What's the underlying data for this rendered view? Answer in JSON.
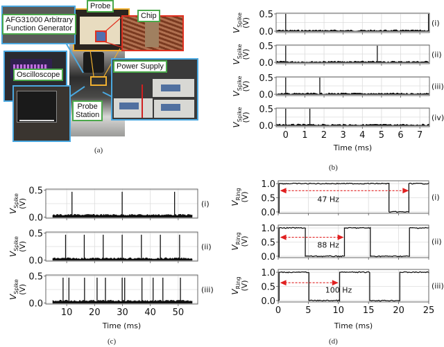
{
  "figure": {
    "panel_a": {
      "caption": "(a)",
      "labels": {
        "afg": "AFG31000 Arbitrary\nFunction Generator",
        "afg_line1": "AFG31000 Arbitrary",
        "afg_line2": "Function Generator",
        "probe": "Probe",
        "chip": "Chip",
        "oscilloscope": "Oscilloscope",
        "power_supply": "Power Supply",
        "probe_station_line1": "Probe",
        "probe_station_line2": "Station"
      },
      "colors": {
        "blue_frame": "#4aa8e0",
        "green_label": "#4aa84a",
        "red_frame": "#e03020",
        "yellow_frame": "#f0b030"
      }
    },
    "panel_b": {
      "caption": "(b)"
    },
    "panel_c": {
      "caption": "(c)"
    },
    "panel_d": {
      "caption": "(d)"
    }
  },
  "chart_data": [
    {
      "id": "b",
      "type": "line",
      "title": "",
      "xlabel": "Time (ms)",
      "ylabel": "V_Spike (V)",
      "xlim": [
        -0.5,
        7.5
      ],
      "ylim": [
        -0.04,
        0.52
      ],
      "xticks": [
        0,
        1,
        2,
        3,
        4,
        5,
        6,
        7
      ],
      "yticks": [
        0.0,
        0.5
      ],
      "ytick_labels": [
        "0.0",
        "0.5"
      ],
      "grid": true,
      "series": [
        {
          "name": "(i)",
          "baseline": 0.02,
          "spikes": [
            0.0,
            7.45
          ],
          "spike_height": 0.5
        },
        {
          "name": "(ii)",
          "baseline": 0.02,
          "spikes": [
            0.0,
            4.78
          ],
          "spike_height": 0.5
        },
        {
          "name": "(iii)",
          "baseline": 0.02,
          "spikes": [
            0.0,
            1.78
          ],
          "spike_height": 0.5
        },
        {
          "name": "(iv)",
          "baseline": 0.02,
          "spikes": [
            0.0,
            1.26
          ],
          "spike_height": 0.5
        }
      ]
    },
    {
      "id": "c",
      "type": "line",
      "title": "",
      "xlabel": "Time (ms)",
      "ylabel": "V_Spike (V)",
      "xlim": [
        2.5,
        57
      ],
      "ylim": [
        -0.02,
        0.52
      ],
      "data_range": [
        5,
        55
      ],
      "xticks": [
        10,
        20,
        30,
        40,
        50
      ],
      "yticks": [
        0.0,
        0.5
      ],
      "ytick_labels": [
        "0.0",
        "0.5"
      ],
      "grid": true,
      "series": [
        {
          "name": "(i)",
          "baseline": 0.04,
          "spikes": [
            11.9,
            29.9,
            48.7
          ],
          "spike_height": 0.47
        },
        {
          "name": "(ii)",
          "baseline": 0.03,
          "spikes": [
            9.6,
            16.3,
            23.1,
            29.9,
            36.8,
            43.6,
            50.5
          ],
          "spike_height": 0.47
        },
        {
          "name": "(iii)",
          "baseline": 0.04,
          "spikes": [
            8.7,
            10.8,
            16.4,
            20.9,
            23.9,
            29.9,
            30.8,
            37.0,
            41.0,
            44.5,
            50.8
          ],
          "spike_height": 0.47
        }
      ]
    },
    {
      "id": "d",
      "type": "line",
      "title": "",
      "xlabel": "Time (ms)",
      "ylabel": "V_Ring (V)",
      "xlim": [
        0,
        25
      ],
      "ylim": [
        -0.05,
        1.1
      ],
      "xticks": [
        0,
        5,
        10,
        15,
        20,
        25
      ],
      "yticks": [
        0.0,
        0.5,
        1.0
      ],
      "ytick_labels": [
        "0.0",
        "0.5",
        "1.0"
      ],
      "grid": true,
      "series": [
        {
          "name": "(i)",
          "frequency_label": "47 Hz",
          "arrow": [
            0.3,
            21.7
          ],
          "arrow_y": 0.75,
          "label_x": 6.5,
          "label_y": 0.45,
          "transitions": [
            [
              0,
              0
            ],
            [
              0.15,
              1
            ],
            [
              18.4,
              0
            ],
            [
              21.7,
              1
            ],
            [
              25,
              1
            ]
          ]
        },
        {
          "name": "(ii)",
          "frequency_label": "88 Hz",
          "arrow": [
            0.3,
            10.9
          ],
          "arrow_y": 0.67,
          "label_x": 6.5,
          "label_y": 0.4,
          "transitions": [
            [
              0,
              0
            ],
            [
              0.15,
              1
            ],
            [
              4.5,
              0
            ],
            [
              11.0,
              1
            ],
            [
              15.3,
              0
            ],
            [
              21.8,
              1
            ],
            [
              25,
              1
            ]
          ]
        },
        {
          "name": "(iii)",
          "frequency_label": "100 Hz",
          "arrow": [
            0.3,
            10.0
          ],
          "arrow_y": 0.63,
          "label_x": 7.8,
          "label_y": 0.38,
          "transitions": [
            [
              0,
              0
            ],
            [
              0.15,
              1
            ],
            [
              5.1,
              0
            ],
            [
              10.2,
              1
            ],
            [
              15.2,
              0
            ],
            [
              20.2,
              1
            ],
            [
              25,
              1
            ]
          ]
        }
      ],
      "annotation_color": "#e02020"
    }
  ]
}
